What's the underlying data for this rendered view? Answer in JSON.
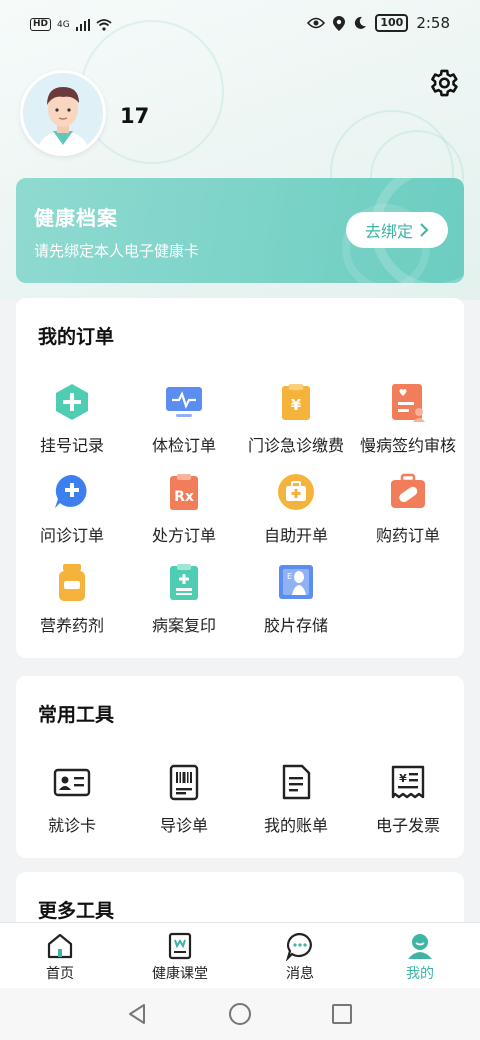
{
  "status_bar": {
    "hd": "HD",
    "network": "4G",
    "time": "2:58",
    "battery": "100"
  },
  "profile": {
    "username": "17"
  },
  "health_card": {
    "title": "健康档案",
    "subtitle": "请先绑定本人电子健康卡",
    "button_label": "去绑定"
  },
  "orders": {
    "title": "我的订单",
    "items": [
      {
        "label": "挂号记录",
        "icon": "register-record-icon"
      },
      {
        "label": "体检订单",
        "icon": "checkup-monitor-icon"
      },
      {
        "label": "门诊急诊缴费",
        "icon": "payment-clipboard-icon"
      },
      {
        "label": "慢病签约审核",
        "icon": "chronic-contract-icon"
      },
      {
        "label": "问诊订单",
        "icon": "consult-chat-icon"
      },
      {
        "label": "处方订单",
        "icon": "prescription-icon"
      },
      {
        "label": "自助开单",
        "icon": "medical-kit-icon"
      },
      {
        "label": "购药订单",
        "icon": "pill-box-icon"
      },
      {
        "label": "营养药剂",
        "icon": "nutrition-bottle-icon"
      },
      {
        "label": "病案复印",
        "icon": "medical-record-icon"
      },
      {
        "label": "胶片存储",
        "icon": "film-xray-icon"
      }
    ]
  },
  "tools": {
    "title": "常用工具",
    "items": [
      {
        "label": "就诊卡",
        "icon": "id-card-icon"
      },
      {
        "label": "导诊单",
        "icon": "barcode-icon"
      },
      {
        "label": "我的账单",
        "icon": "bill-icon"
      },
      {
        "label": "电子发票",
        "icon": "invoice-icon"
      }
    ]
  },
  "more_tools": {
    "title": "更多工具"
  },
  "tabbar": {
    "items": [
      {
        "label": "首页",
        "icon": "home-icon"
      },
      {
        "label": "健康课堂",
        "icon": "health-class-icon"
      },
      {
        "label": "消息",
        "icon": "message-icon"
      },
      {
        "label": "我的",
        "icon": "profile-icon",
        "active": true
      }
    ]
  },
  "colors": {
    "accent": "#3fb4a5",
    "card_gradient_start": "#8fdad1",
    "card_gradient_end": "#6ccdc0"
  }
}
